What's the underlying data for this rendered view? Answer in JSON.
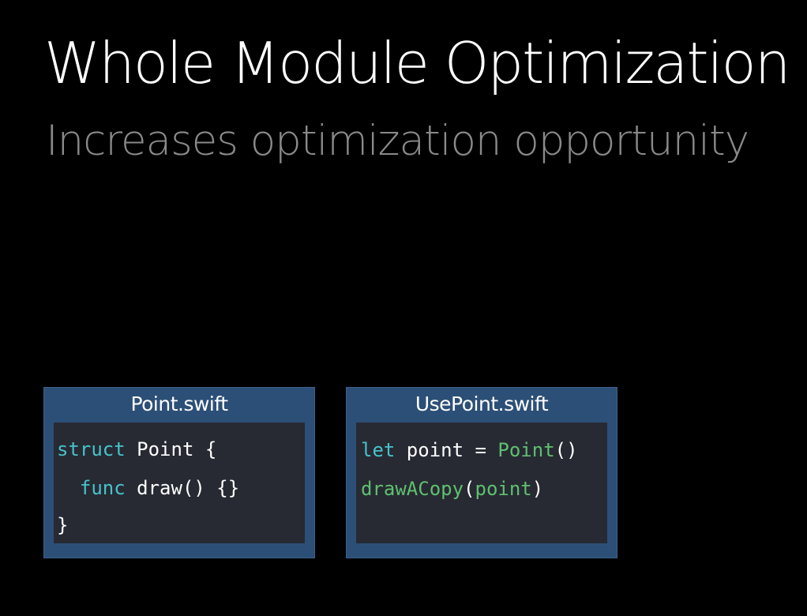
{
  "slide": {
    "title": "Whole Module Optimization",
    "subtitle": "Increases optimization opportunity"
  },
  "files": {
    "point": {
      "name": "Point.swift",
      "line1": {
        "keyword": "struct",
        "rest": " Point {"
      },
      "line2": {
        "indent": "  ",
        "keyword": "func",
        "rest": " draw() {}"
      },
      "line3": {
        "text": "}"
      }
    },
    "usepoint": {
      "name": "UsePoint.swift",
      "line1": {
        "keyword": "let",
        "plain": " point = ",
        "call": "Point",
        "tail": "()"
      },
      "line2": {
        "call": "drawACopy",
        "open": "(",
        "arg": "point",
        "close": ")"
      }
    }
  },
  "colors": {
    "background": "#000000",
    "title": "#ffffff",
    "subtitle": "#8a8a8a",
    "card": "#2c4f77",
    "code_bg": "#272a33",
    "keyword": "#48c2cb",
    "function": "#5fc06f",
    "plain": "#ffffff"
  }
}
